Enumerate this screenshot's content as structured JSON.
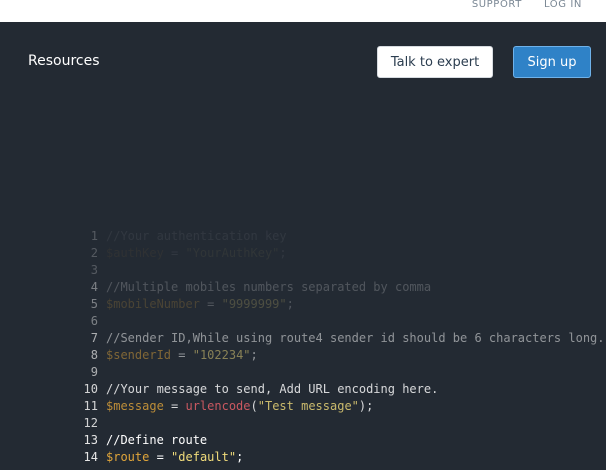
{
  "topnav": {
    "support": "SUPPORT",
    "login": "LOG IN"
  },
  "header": {
    "title": "Resources",
    "talk_button": "Talk to expert",
    "signup_button": "Sign up"
  },
  "code": {
    "lines": [
      {
        "n": "1",
        "parts": [
          {
            "t": "cm",
            "v": "//Your authentication key"
          }
        ]
      },
      {
        "n": "2",
        "parts": [
          {
            "t": "var",
            "v": "$authKey"
          },
          {
            "t": "op",
            "v": " = "
          },
          {
            "t": "str",
            "v": "\"YourAuthKey\""
          },
          {
            "t": "op",
            "v": ";"
          }
        ]
      },
      {
        "n": "3",
        "parts": []
      },
      {
        "n": "4",
        "parts": [
          {
            "t": "cm",
            "v": "//Multiple mobiles numbers separated by comma"
          }
        ]
      },
      {
        "n": "5",
        "parts": [
          {
            "t": "var",
            "v": "$mobileNumber"
          },
          {
            "t": "op",
            "v": " = "
          },
          {
            "t": "str",
            "v": "\"9999999\""
          },
          {
            "t": "op",
            "v": ";"
          }
        ]
      },
      {
        "n": "6",
        "parts": []
      },
      {
        "n": "7",
        "parts": [
          {
            "t": "cm",
            "v": "//Sender ID,While using route4 sender id should be 6 characters long."
          }
        ]
      },
      {
        "n": "8",
        "parts": [
          {
            "t": "var",
            "v": "$senderId"
          },
          {
            "t": "op",
            "v": " = "
          },
          {
            "t": "str",
            "v": "\"102234\""
          },
          {
            "t": "op",
            "v": ";"
          }
        ]
      },
      {
        "n": "9",
        "parts": []
      },
      {
        "n": "10",
        "parts": [
          {
            "t": "cm",
            "v": "//Your message to send, Add URL encoding here."
          }
        ]
      },
      {
        "n": "11",
        "parts": [
          {
            "t": "var",
            "v": "$message"
          },
          {
            "t": "op",
            "v": " = "
          },
          {
            "t": "fn",
            "v": "urlencode"
          },
          {
            "t": "op",
            "v": "("
          },
          {
            "t": "str",
            "v": "\"Test message\""
          },
          {
            "t": "op",
            "v": ");"
          }
        ]
      },
      {
        "n": "12",
        "parts": []
      },
      {
        "n": "13",
        "parts": [
          {
            "t": "cm",
            "v": "//Define route"
          }
        ]
      },
      {
        "n": "14",
        "parts": [
          {
            "t": "var",
            "v": "$route"
          },
          {
            "t": "op",
            "v": " = "
          },
          {
            "t": "str",
            "v": "\"default\""
          },
          {
            "t": "op",
            "v": ";"
          }
        ]
      }
    ]
  },
  "colors": {
    "background": "#232a33",
    "accent": "#2f82c7",
    "variable": "#e0a53a",
    "string": "#f1dc7b",
    "function": "#f0636b"
  }
}
